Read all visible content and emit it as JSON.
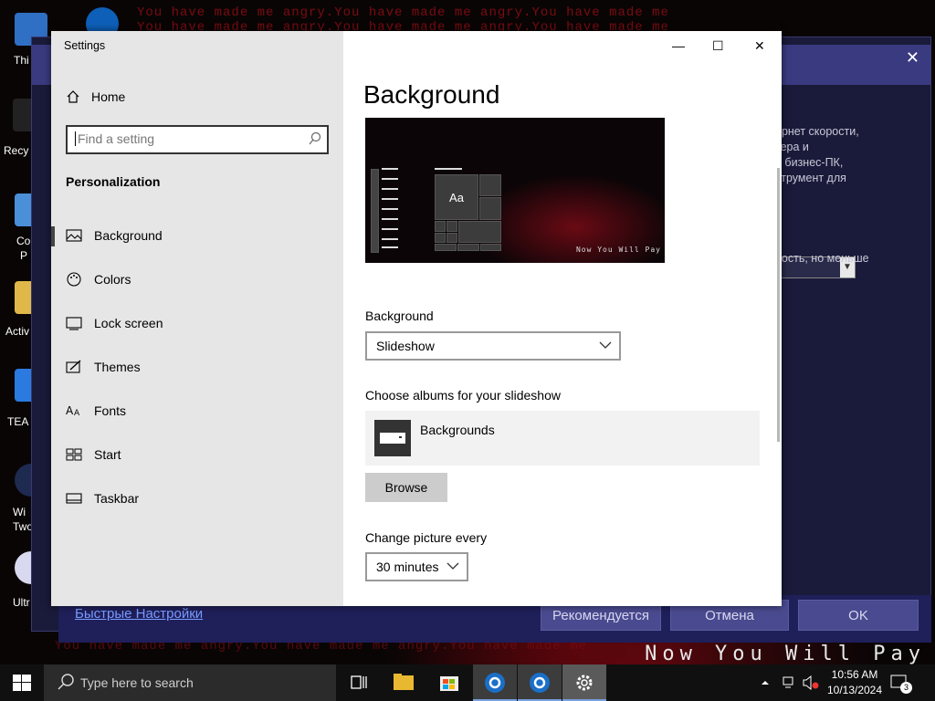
{
  "desktop": {
    "wallpaper_repeat_text": "You have made me angry.You have made me angry.You have made me",
    "wallpaper_caption": "Now You Will Pay",
    "icon_labels": [
      "Thi",
      "Recy",
      "Co",
      "P",
      "Activ",
      "TEA",
      "Wi",
      "Two",
      "Ultr"
    ]
  },
  "background_app": {
    "text_lines": [
      "ернет скорости,",
      "тера и",
      "а бизнес-ПК,",
      "струмент для",
      "ность, но меньше"
    ],
    "link": "Быстрые Настройки",
    "buttons": {
      "recommended": "Рекомендуется",
      "cancel": "Отмена",
      "ok": "OK"
    }
  },
  "settings": {
    "window_title": "Settings",
    "home_label": "Home",
    "search_placeholder": "Find a setting",
    "section_title": "Personalization",
    "nav_items": [
      {
        "label": "Background",
        "icon": "picture-icon",
        "active": true
      },
      {
        "label": "Colors",
        "icon": "palette-icon",
        "active": false
      },
      {
        "label": "Lock screen",
        "icon": "lock-screen-icon",
        "active": false
      },
      {
        "label": "Themes",
        "icon": "themes-icon",
        "active": false
      },
      {
        "label": "Fonts",
        "icon": "fonts-icon",
        "active": false
      },
      {
        "label": "Start",
        "icon": "start-icon",
        "active": false
      },
      {
        "label": "Taskbar",
        "icon": "taskbar-icon",
        "active": false
      }
    ],
    "page_title": "Background",
    "preview_tile_label": "Aa",
    "preview_caption": "Now You Will Pay",
    "background_label": "Background",
    "background_value": "Slideshow",
    "albums_label": "Choose albums for your slideshow",
    "album_name": "Backgrounds",
    "browse_label": "Browse",
    "change_label": "Change picture every",
    "change_value": "30 minutes"
  },
  "taskbar": {
    "search_text": "Type here to search",
    "time": "10:56 AM",
    "date": "10/13/2024",
    "notification_count": "3"
  },
  "colors": {
    "accent_active": "#3c3c3c",
    "bg_app_purple": "#3a3a80",
    "wallpaper_red": "#7a0c12"
  }
}
